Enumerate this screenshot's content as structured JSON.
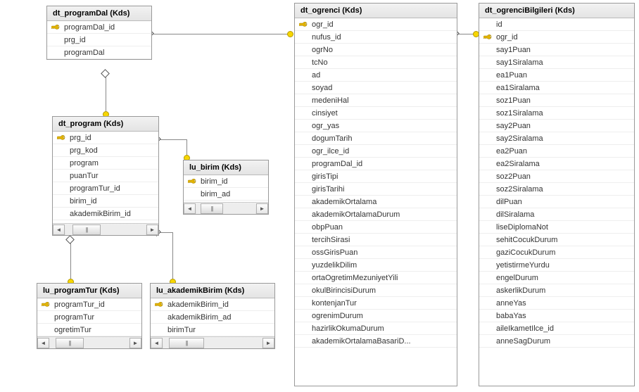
{
  "tables": {
    "programDal": {
      "title": "dt_programDal (Kds)",
      "columns": [
        {
          "name": "programDal_id",
          "pk": true
        },
        {
          "name": "prg_id",
          "pk": false
        },
        {
          "name": "programDal",
          "pk": false
        }
      ]
    },
    "program": {
      "title": "dt_program (Kds)",
      "columns": [
        {
          "name": "prg_id",
          "pk": true
        },
        {
          "name": "prg_kod",
          "pk": false
        },
        {
          "name": "program",
          "pk": false
        },
        {
          "name": "puanTur",
          "pk": false
        },
        {
          "name": "programTur_id",
          "pk": false
        },
        {
          "name": "birim_id",
          "pk": false
        },
        {
          "name": "akademikBirim_id",
          "pk": false
        }
      ]
    },
    "birim": {
      "title": "lu_birim (Kds)",
      "columns": [
        {
          "name": "birim_id",
          "pk": true
        },
        {
          "name": "birim_ad",
          "pk": false
        }
      ]
    },
    "programTur": {
      "title": "lu_programTur (Kds)",
      "columns": [
        {
          "name": "programTur_id",
          "pk": true
        },
        {
          "name": "programTur",
          "pk": false
        },
        {
          "name": "ogretimTur",
          "pk": false
        }
      ]
    },
    "akademikBirim": {
      "title": "lu_akademikBirim (Kds)",
      "columns": [
        {
          "name": "akademikBirim_id",
          "pk": true
        },
        {
          "name": "akademikBirim_ad",
          "pk": false
        },
        {
          "name": "birimTur",
          "pk": false
        }
      ]
    },
    "ogrenci": {
      "title": "dt_ogrenci (Kds)",
      "columns": [
        {
          "name": "ogr_id",
          "pk": true
        },
        {
          "name": "nufus_id",
          "pk": false
        },
        {
          "name": "ogrNo",
          "pk": false
        },
        {
          "name": "tcNo",
          "pk": false
        },
        {
          "name": "ad",
          "pk": false
        },
        {
          "name": "soyad",
          "pk": false
        },
        {
          "name": "medeniHal",
          "pk": false
        },
        {
          "name": "cinsiyet",
          "pk": false
        },
        {
          "name": "ogr_yas",
          "pk": false
        },
        {
          "name": "dogumTarih",
          "pk": false
        },
        {
          "name": "ogr_ilce_id",
          "pk": false
        },
        {
          "name": "programDal_id",
          "pk": false
        },
        {
          "name": "girisTipi",
          "pk": false
        },
        {
          "name": "girisTarihi",
          "pk": false
        },
        {
          "name": "akademikOrtalama",
          "pk": false
        },
        {
          "name": "akademikOrtalamaDurum",
          "pk": false
        },
        {
          "name": "obpPuan",
          "pk": false
        },
        {
          "name": "tercihSirasi",
          "pk": false
        },
        {
          "name": "ossGirisPuan",
          "pk": false
        },
        {
          "name": "yuzdelikDilim",
          "pk": false
        },
        {
          "name": "ortaOgretimMezuniyetYili",
          "pk": false
        },
        {
          "name": "okulBirincisiDurum",
          "pk": false
        },
        {
          "name": "kontenjanTur",
          "pk": false
        },
        {
          "name": "ogrenimDurum",
          "pk": false
        },
        {
          "name": "hazirlikOkumaDurum",
          "pk": false
        },
        {
          "name": "akademikOrtalamaBasariD...",
          "pk": false
        }
      ]
    },
    "ogrenciBilgileri": {
      "title": "dt_ogrenciBilgileri (Kds)",
      "columns": [
        {
          "name": "id",
          "pk": false
        },
        {
          "name": "ogr_id",
          "pk": true
        },
        {
          "name": "say1Puan",
          "pk": false
        },
        {
          "name": "say1Siralama",
          "pk": false
        },
        {
          "name": "ea1Puan",
          "pk": false
        },
        {
          "name": "ea1Siralama",
          "pk": false
        },
        {
          "name": "soz1Puan",
          "pk": false
        },
        {
          "name": "soz1Siralama",
          "pk": false
        },
        {
          "name": "say2Puan",
          "pk": false
        },
        {
          "name": "say2Siralama",
          "pk": false
        },
        {
          "name": "ea2Puan",
          "pk": false
        },
        {
          "name": "ea2Siralama",
          "pk": false
        },
        {
          "name": "soz2Puan",
          "pk": false
        },
        {
          "name": "soz2Siralama",
          "pk": false
        },
        {
          "name": "dilPuan",
          "pk": false
        },
        {
          "name": "dilSiralama",
          "pk": false
        },
        {
          "name": "liseDiplomaNot",
          "pk": false
        },
        {
          "name": "sehitCocukDurum",
          "pk": false
        },
        {
          "name": "gaziCocukDurum",
          "pk": false
        },
        {
          "name": "yetistirmeYurdu",
          "pk": false
        },
        {
          "name": "engelDurum",
          "pk": false
        },
        {
          "name": "askerlikDurum",
          "pk": false
        },
        {
          "name": "anneYas",
          "pk": false
        },
        {
          "name": "babaYas",
          "pk": false
        },
        {
          "name": "aileIkametIlce_id",
          "pk": false
        },
        {
          "name": "anneSagDurum",
          "pk": false
        }
      ]
    }
  }
}
